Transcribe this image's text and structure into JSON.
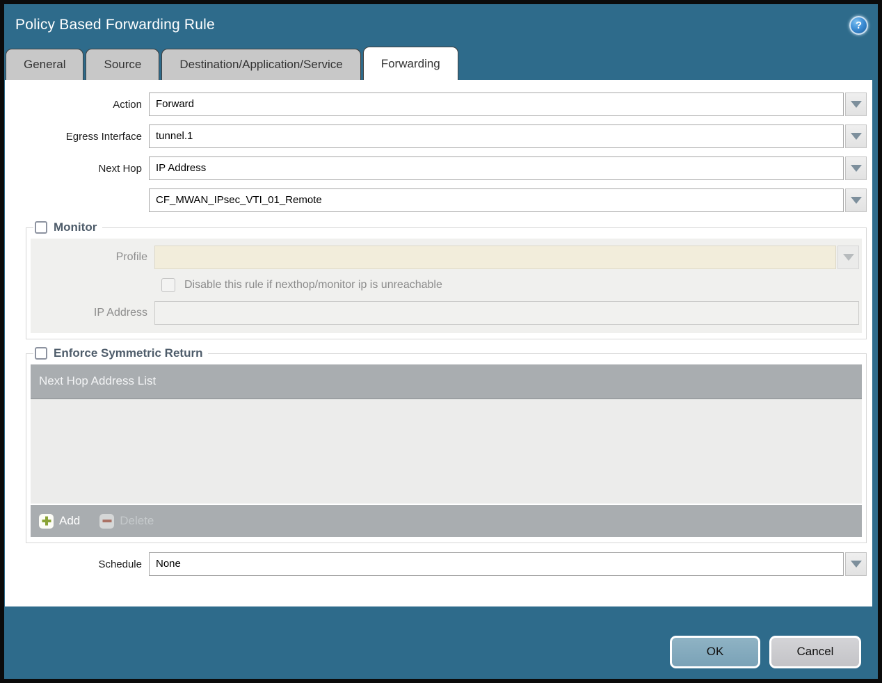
{
  "dialog": {
    "title": "Policy Based Forwarding Rule"
  },
  "help": {
    "glyph": "?"
  },
  "tabs": [
    {
      "label": "General",
      "active": false
    },
    {
      "label": "Source",
      "active": false
    },
    {
      "label": "Destination/Application/Service",
      "active": false
    },
    {
      "label": "Forwarding",
      "active": true
    }
  ],
  "form": {
    "action_label": "Action",
    "action_value": "Forward",
    "egress_label": "Egress Interface",
    "egress_value": "tunnel.1",
    "nexthop_label": "Next Hop",
    "nexthop_value": "IP Address",
    "nexthop_address_value": "CF_MWAN_IPsec_VTI_01_Remote",
    "schedule_label": "Schedule",
    "schedule_value": "None"
  },
  "monitor": {
    "legend": "Monitor",
    "checked": false,
    "profile_label": "Profile",
    "profile_value": "",
    "disable_label": "Disable this rule if nexthop/monitor ip is unreachable",
    "disable_checked": false,
    "ip_label": "IP Address",
    "ip_value": ""
  },
  "symmetric": {
    "legend": "Enforce Symmetric Return",
    "checked": false,
    "table_header": "Next Hop Address List",
    "add_label": "Add",
    "delete_label": "Delete"
  },
  "footer": {
    "ok_label": "OK",
    "cancel_label": "Cancel"
  },
  "colors": {
    "titlebar_teal": "#2e6b8b",
    "tab_inactive": "#c8c8c8",
    "table_gray": "#a9adb0",
    "table_body": "#ececeb",
    "disabled_beige": "#f2eddb",
    "legend_text": "#4e5c6a",
    "ok_button": "#7fa9bd",
    "cancel_button": "#c9c9cd",
    "add_plus_green": "#8aa336",
    "delete_minus_red": "#aa7265"
  }
}
